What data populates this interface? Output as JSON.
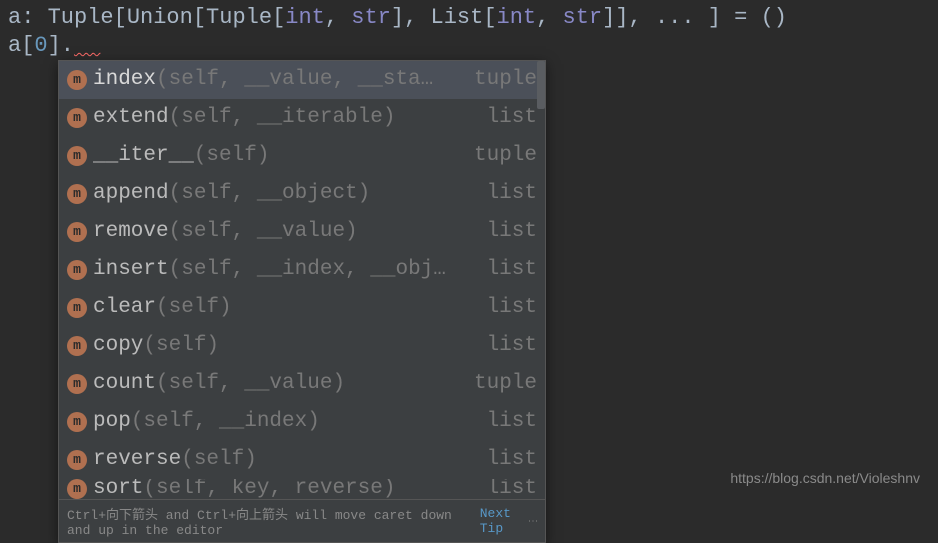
{
  "code": {
    "line1_parts": {
      "a": "a",
      "colon": ": ",
      "tuple1": "Tuple",
      "b1": "[",
      "union": "Union",
      "b2": "[",
      "tuple2": "Tuple",
      "b3": "[",
      "int1": "int",
      "c1": ", ",
      "str1": "str",
      "b4": "], ",
      "list": "List",
      "b5": "[",
      "int2": "int",
      "c2": ", ",
      "str2": "str",
      "b6": "]], ",
      "ellipsis": "... ",
      "b7": "] ",
      "eq": "= ",
      "paren": "()"
    },
    "line2_parts": {
      "a": "a",
      "b1": "[",
      "zero": "0",
      "b2": "].",
      "err": "  "
    }
  },
  "completion": {
    "items": [
      {
        "name": "index",
        "params": "(self, __value, __sta…",
        "type": "tuple",
        "selected": true
      },
      {
        "name": "extend",
        "params": "(self, __iterable)",
        "type": "list",
        "selected": false
      },
      {
        "name": "__iter__",
        "params": "(self)",
        "type": "tuple",
        "selected": false
      },
      {
        "name": "append",
        "params": "(self, __object)",
        "type": "list",
        "selected": false
      },
      {
        "name": "remove",
        "params": "(self, __value)",
        "type": "list",
        "selected": false
      },
      {
        "name": "insert",
        "params": "(self, __index, __obj…",
        "type": "list",
        "selected": false
      },
      {
        "name": "clear",
        "params": "(self)",
        "type": "list",
        "selected": false
      },
      {
        "name": "copy",
        "params": "(self)",
        "type": "list",
        "selected": false
      },
      {
        "name": "count",
        "params": "(self, __value)",
        "type": "tuple",
        "selected": false
      },
      {
        "name": "pop",
        "params": "(self, __index)",
        "type": "list",
        "selected": false
      },
      {
        "name": "reverse",
        "params": "(self)",
        "type": "list",
        "selected": false
      },
      {
        "name": "sort",
        "params": "(self, key, reverse)",
        "type": "list",
        "selected": false
      }
    ],
    "hint_text": "Ctrl+向下箭头 and Ctrl+向上箭头 will move caret down and up in the editor",
    "hint_link": "Next Tip"
  },
  "watermark": "https://blog.csdn.net/Violeshnv"
}
